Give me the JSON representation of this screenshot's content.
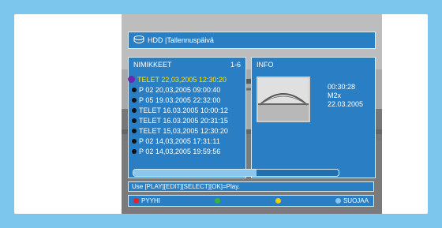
{
  "header": {
    "source": "HDD",
    "title": "Tallennuspäivä"
  },
  "list": {
    "heading": "NIMIKKEET",
    "range": "1-6",
    "selected_index": 0,
    "items": [
      {
        "label": "TELET 22,03,2005 12:30:20"
      },
      {
        "label": "P 02 20,03,2005 09:00:40"
      },
      {
        "label": "P 05 19.03.2005 22:32:00"
      },
      {
        "label": "TELET 16.03.2005 10:00:12"
      },
      {
        "label": "TELET 16.03.2005 20:31:15"
      },
      {
        "label": "TELET 15,03,2005 12:30:20"
      },
      {
        "label": "P 02 14,03,2005 17:31:11"
      },
      {
        "label": "P 02 14,03,2005 19:59:56"
      }
    ]
  },
  "info": {
    "heading": "INFO",
    "duration": "00:30:28",
    "mode": "M2x",
    "date": "22.03.2005"
  },
  "progress": {
    "fraction": 0.6
  },
  "help_text": "Use [PLAY][EDIT][SELECT][OK]=Play.",
  "color_buttons": {
    "red": {
      "label": "PYYHI",
      "color": "#e8202a"
    },
    "green": {
      "label": "",
      "color": "#3cb43c"
    },
    "yellow": {
      "label": "",
      "color": "#f2d000"
    },
    "blue": {
      "label": "SUOJAA",
      "color": "#8ac8f0"
    }
  }
}
